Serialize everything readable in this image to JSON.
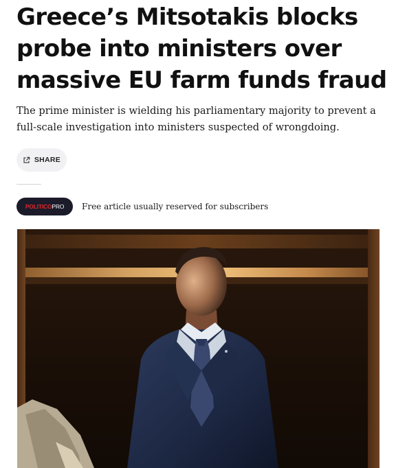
{
  "article": {
    "headline": "Greece’s Mitsotakis blocks probe into ministers over massive EU farm funds fraud",
    "dek": "The prime minister is wielding his parliamentary majority to prevent a full-scale investigation into ministers suspected of wrongdoing.",
    "share_label": "SHARE",
    "share_icon": "external-link-icon",
    "badge": {
      "brand": "POLITICO",
      "tier": "PRO"
    },
    "subscriber_note": "Free article usually reserved for subscribers",
    "photo": "lead-photo-man-in-dark-suit"
  },
  "colors": {
    "badge_background": "#1b1b2a",
    "badge_brand_red": "#e0262b",
    "share_button_background": "#f1f1f3",
    "text": "#111111"
  }
}
